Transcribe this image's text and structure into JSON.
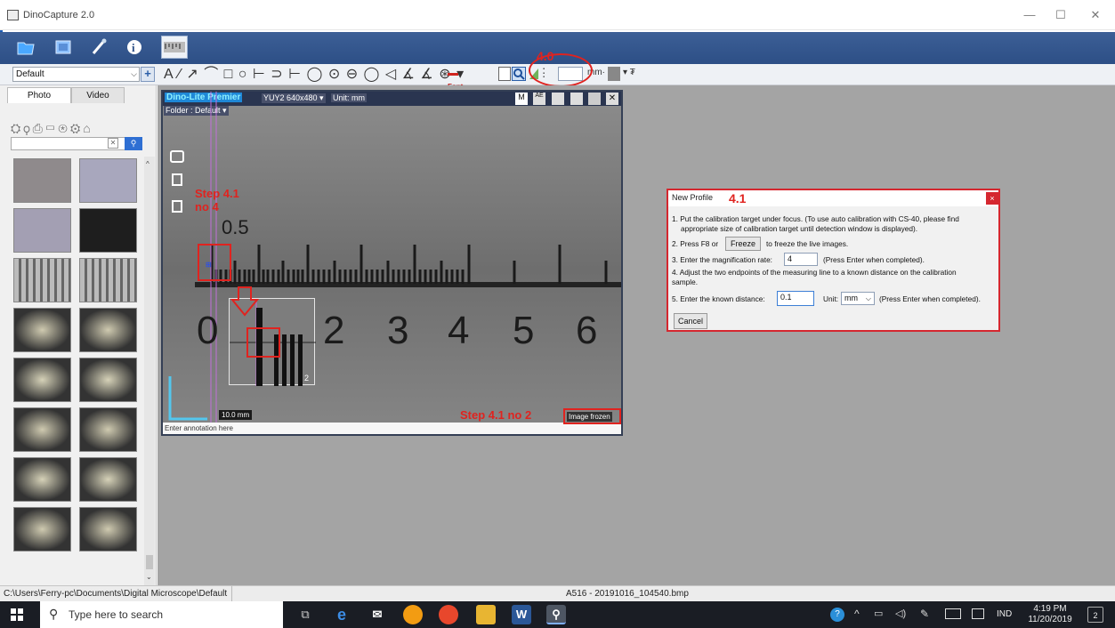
{
  "app": {
    "title": "DinoCapture 2.0"
  },
  "window_controls": {
    "minimize": "—",
    "maximize": "☐",
    "close": "✕"
  },
  "toolbar": {
    "profile_select": "Default",
    "add_label": "+",
    "draw_tools": "A ⁄ ↗ ⌒ □ ○ ⊢ ⊃ ⊢ ◯ ⊙ ⊖ ◯ ◁ ∡ ∡ ⊛ ▾ ",
    "font_label": "Font",
    "calib_value": "",
    "unit_menu": "mm·"
  },
  "panel": {
    "tabs": [
      "Photo",
      "Video"
    ],
    "search_placeholder": "",
    "thumb_count": 16
  },
  "viewer": {
    "device_title": "Dino-Lite Premier",
    "resolution": "YUY2 640x480 ▾",
    "unit": "Unit: mm",
    "folder": "Folder : Default ▾",
    "scale_bar": "10.0 mm",
    "annotation_hint": "Enter annotation here",
    "frozen_badge": "Image frozen",
    "ruler_top_label": "0.5",
    "ruler_numbers": [
      "0",
      "2",
      "3",
      "4",
      "5",
      "6"
    ],
    "inset_tick_label": "2"
  },
  "annotations": {
    "step_4_0": "4.0",
    "step_4_1_no4_line1": "Step 4.1",
    "step_4_1_no4_line2": "no 4",
    "step_4_1_no2": "Step 4.1 no 2",
    "dialog_step": "4.1"
  },
  "dialog": {
    "title": "New Profile",
    "close": "×",
    "line1": "1. Put the calibration target under focus. (To use auto calibration with CS-40, please find",
    "line1b": "appropriate size of calibration target until detection window is displayed).",
    "line2_pre": "2. Press F8 or",
    "freeze_btn": "Freeze",
    "line2_post": "to freeze the live images.",
    "line3_pre": "3. Enter the magnification rate:",
    "magnification": "4",
    "line3_post": "(Press Enter when completed).",
    "line4": "4. Adjust the two endpoints of the measuring line to a known distance on the calibration",
    "line4b": "sample.",
    "line5_pre": "5. Enter the known distance:",
    "distance": "0.1",
    "unit_label": "Unit:",
    "unit_value": "mm",
    "line5_post": "(Press Enter when completed).",
    "cancel": "Cancel"
  },
  "status": {
    "path": "C:\\Users\\Ferry-pc\\Documents\\Digital Microscope\\Default",
    "file": "A516 - 20191016_104540.bmp"
  },
  "taskbar": {
    "search_placeholder": "Type here to search",
    "lang": "IND",
    "time": "4:19 PM",
    "date": "11/20/2019",
    "notif_count": "2"
  }
}
